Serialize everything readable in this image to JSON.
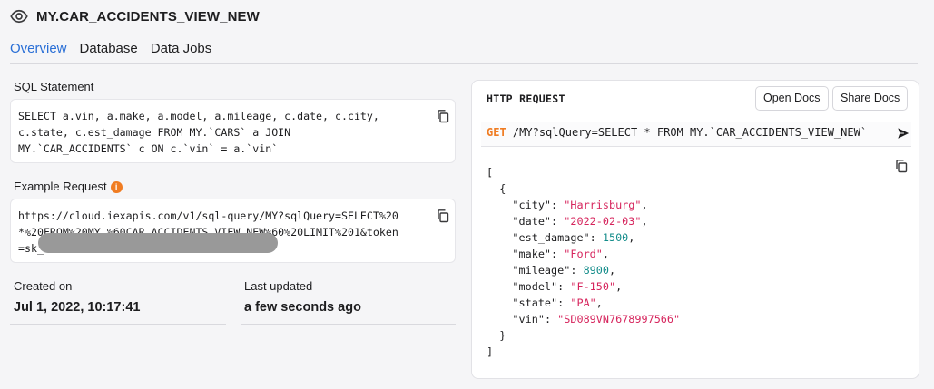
{
  "header": {
    "title": "MY.CAR_ACCIDENTS_VIEW_NEW",
    "icon": "eye-icon"
  },
  "tabs": [
    {
      "label": "Overview",
      "active": true
    },
    {
      "label": "Database",
      "active": false
    },
    {
      "label": "Data Jobs",
      "active": false
    }
  ],
  "sql": {
    "label": "SQL Statement",
    "lines": [
      "SELECT a.vin, a.make, a.model, a.mileage, c.date, c.city,",
      "c.state, c.est_damage FROM MY.`CARS` a JOIN",
      "MY.`CAR_ACCIDENTS` c ON c.`vin` = a.`vin`"
    ]
  },
  "example": {
    "label": "Example Request",
    "lines": [
      "https://cloud.iexapis.com/v1/sql-query/MY?sqlQuery=SELECT%20",
      "*%20FROM%20MY.%60CAR_ACCIDENTS_VIEW_NEW%60%20LIMIT%201&token",
      "=sk_"
    ]
  },
  "created": {
    "label": "Created on",
    "value": "Jul 1, 2022, 10:17:41"
  },
  "updated": {
    "label": "Last updated",
    "value": "a few seconds ago"
  },
  "http": {
    "title": "HTTP REQUEST",
    "open_docs": "Open Docs",
    "share_docs": "Share Docs",
    "method": "GET",
    "url": "/MY?sqlQuery=SELECT * FROM MY.`CAR_ACCIDENTS_VIEW_NEW`",
    "response": {
      "open_bracket": "[",
      "open_brace": "{",
      "fields": [
        {
          "key": "\"city\"",
          "value": "\"Harrisburg\"",
          "type": "string",
          "comma": ","
        },
        {
          "key": "\"date\"",
          "value": "\"2022-02-03\"",
          "type": "string",
          "comma": ","
        },
        {
          "key": "\"est_damage\"",
          "value": "1500",
          "type": "number",
          "comma": ","
        },
        {
          "key": "\"make\"",
          "value": "\"Ford\"",
          "type": "string",
          "comma": ","
        },
        {
          "key": "\"mileage\"",
          "value": "8900",
          "type": "number",
          "comma": ","
        },
        {
          "key": "\"model\"",
          "value": "\"F-150\"",
          "type": "string",
          "comma": ","
        },
        {
          "key": "\"state\"",
          "value": "\"PA\"",
          "type": "string",
          "comma": ","
        },
        {
          "key": "\"vin\"",
          "value": "\"SD089VN7678997566\"",
          "type": "string",
          "comma": ""
        }
      ],
      "close_brace": "}",
      "close_bracket": "]"
    }
  },
  "colors": {
    "accent": "#2a6fd6",
    "method": "#f07c22",
    "string": "#d6245c",
    "number": "#138c8a",
    "info": "#f07c22"
  }
}
